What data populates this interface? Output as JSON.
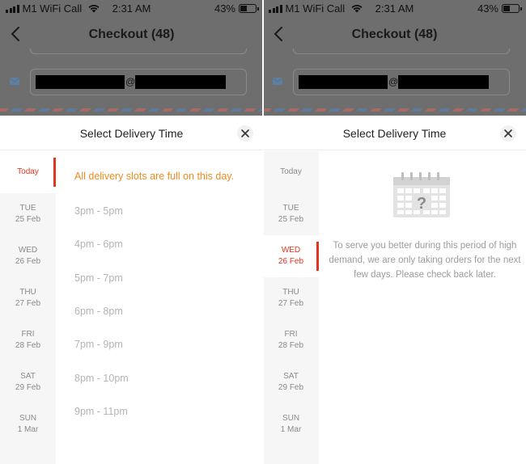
{
  "status": {
    "carrier": "M1 WiFi Call",
    "time": "2:31 AM",
    "battery_pct": "43%",
    "battery_level": 0.43
  },
  "header": {
    "title": "Checkout (48)"
  },
  "email": {
    "at": "@"
  },
  "sheet": {
    "title": "Select Delivery Time"
  },
  "days": [
    {
      "name": "Today",
      "date": ""
    },
    {
      "name": "TUE",
      "date": "25 Feb"
    },
    {
      "name": "WED",
      "date": "26 Feb"
    },
    {
      "name": "THU",
      "date": "27 Feb"
    },
    {
      "name": "FRI",
      "date": "28 Feb"
    },
    {
      "name": "SAT",
      "date": "29 Feb"
    },
    {
      "name": "SUN",
      "date": "1 Mar"
    }
  ],
  "left_panel": {
    "selected_day_index": 0,
    "full_message": "All delivery slots are full on this day.",
    "slots": [
      "3pm - 5pm",
      "4pm - 6pm",
      "5pm - 7pm",
      "6pm - 8pm",
      "7pm - 9pm",
      "8pm - 10pm",
      "9pm - 11pm"
    ]
  },
  "right_panel": {
    "selected_day_index": 2,
    "info_message": "To serve you better during this period of high demand, we are only taking orders for the next few days. Please check back later."
  },
  "colors": {
    "accent": "#e0351e",
    "warning": "#f08a1c",
    "muted": "#b4b4b4",
    "overlay": "#6e6e6e"
  },
  "icons": [
    "back-chevron-icon",
    "mail-icon",
    "close-icon",
    "calendar-question-icon",
    "wifi-icon",
    "battery-icon",
    "signal-icon"
  ]
}
